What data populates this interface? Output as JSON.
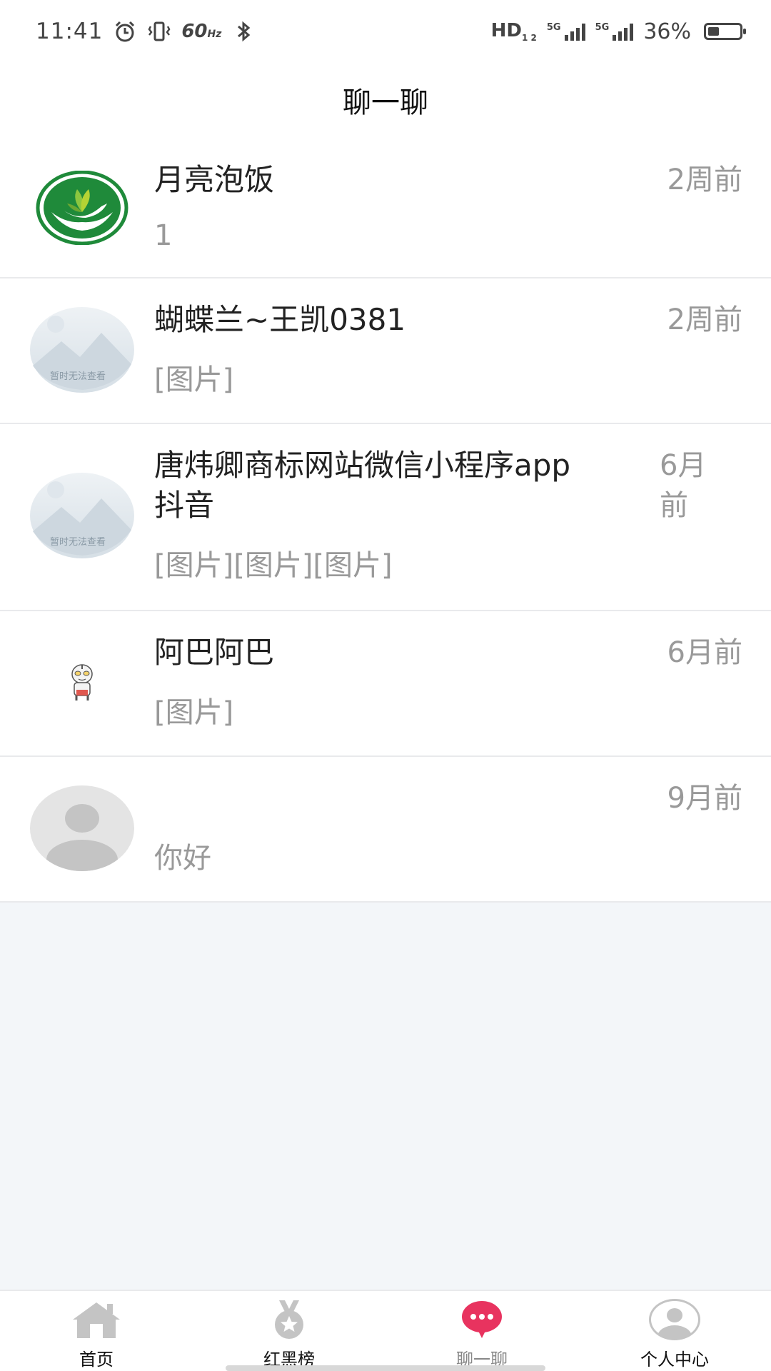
{
  "status_bar": {
    "time": "11:41",
    "refresh_rate": "60",
    "refresh_unit": "Hz",
    "hd": "HD",
    "hd_sub": "1 2",
    "sim1_label": "5G",
    "sim2_label": "5G",
    "battery": "36%",
    "battery_level": 0.36
  },
  "header": {
    "title": "聊一聊"
  },
  "chats": [
    {
      "name": "月亮泡饭",
      "preview": "1",
      "time": "2周前",
      "avatar": "green-logo-avatar"
    },
    {
      "name": "蝴蝶兰~王凯0381",
      "preview": "[图片]",
      "time": "2周前",
      "avatar": "placeholder-image-avatar",
      "avatar_text": "暂时无法查看"
    },
    {
      "name_line1": "唐炜卿商标网站微信小程序app",
      "name_line2": "抖音",
      "preview": "[图片][图片][图片]",
      "time_line1": "6月",
      "time_line2": "前",
      "avatar": "placeholder-image-avatar",
      "avatar_text": "暂时无法查看"
    },
    {
      "name": "阿巴阿巴",
      "preview": "[图片]",
      "time": "6月前",
      "avatar": "cartoon-avatar"
    },
    {
      "name": "",
      "preview": "你好",
      "time": "9月前",
      "avatar": "default-user-avatar"
    }
  ],
  "tabbar": {
    "tabs": [
      {
        "label": "首页",
        "icon": "home-icon"
      },
      {
        "label": "红黑榜",
        "icon": "medal-icon"
      },
      {
        "label": "聊一聊",
        "icon": "chat-bubble-icon",
        "active": true
      },
      {
        "label": "个人中心",
        "icon": "user-icon"
      }
    ]
  },
  "colors": {
    "accent": "#e8335f",
    "logo_green": "#1f8a3a",
    "tab_icon_gray": "#c4c4c4",
    "text_muted": "#999999"
  }
}
